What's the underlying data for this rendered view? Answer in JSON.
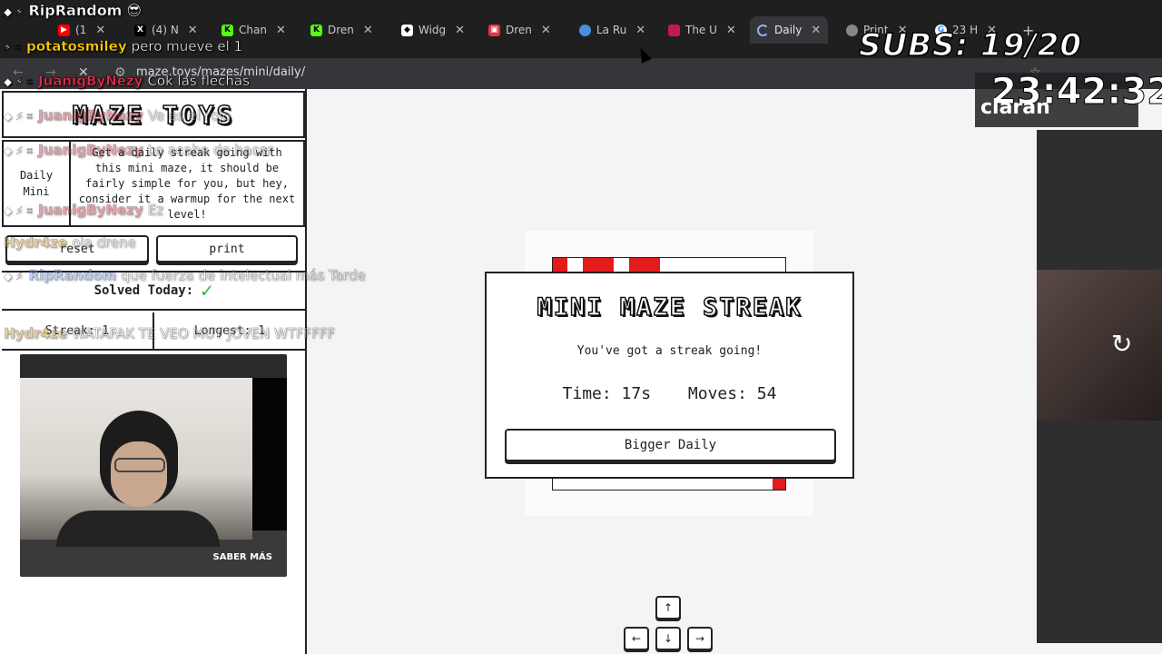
{
  "browser": {
    "tabs": [
      {
        "label": "(1",
        "fav": "youtube-icon",
        "color": "#ff0000"
      },
      {
        "label": "(4) N",
        "fav": "x-icon",
        "color": "#000000"
      },
      {
        "label": "Chan",
        "fav": "kick-icon",
        "color": "#53fc18"
      },
      {
        "label": "Dren",
        "fav": "kick-icon",
        "color": "#53fc18"
      },
      {
        "label": "Widg",
        "fav": "widget-icon",
        "color": "#ffffff"
      },
      {
        "label": "Dren",
        "fav": "app-icon",
        "color": "#e2344a"
      },
      {
        "label": "La Ru",
        "fav": "globe-icon",
        "color": "#4a90e2"
      },
      {
        "label": "The U",
        "fav": "app-icon",
        "color": "#c2185b"
      },
      {
        "label": "Daily",
        "fav": "loading-icon",
        "color": "#8ab4f8"
      },
      {
        "label": "Print",
        "fav": "globe-icon",
        "color": "#aaaaaa"
      },
      {
        "label": "23 H",
        "fav": "google-icon",
        "color": "#ffffff"
      }
    ],
    "url": "maze.toys/mazes/mini/daily/"
  },
  "page": {
    "logo": "MAZE TOYS",
    "tag_line1": "Daily",
    "tag_line2": "Mini",
    "info": "Get a daily streak going with this mini maze, it should be fairly simple for you, but hey, consider it a warmup for the next level!",
    "reset_label": "reset",
    "print_label": "print",
    "solved_label": "Solved Today:",
    "streak_label": "Streak: 1",
    "longest_label": "Longest: 1"
  },
  "modal": {
    "title": "MINI MAZE STREAK",
    "subtitle": "You've got a streak going!",
    "time": "Time: 17s",
    "moves": "Moves: 54",
    "button": "Bigger Daily"
  },
  "keys": {
    "up": "↑",
    "left": "←",
    "down": "↓",
    "right": "→"
  },
  "overlay": {
    "streamer": "RipRandom",
    "subs": "SUBS: 19/20",
    "clock": "23:42:32",
    "clock_sub": "claran",
    "saber_mas": "SABER MÁS",
    "chat": [
      {
        "user": "potatosmiley",
        "msg": "pero mueve el 1",
        "color": "#ffcc00"
      },
      {
        "user": "JuanigByNezy",
        "msg": "Cok las flechas",
        "color": "#d92c4a"
      },
      {
        "user": "JuanigByNezy",
        "msg": "Ve es el rojo",
        "color": "#d92c4a"
      },
      {
        "user": "JuanigByNezy",
        "msg": "Lo acabo de hacer",
        "color": "#d92c4a"
      },
      {
        "user": "JuanigByNezy",
        "msg": "Ez",
        "color": "#d92c4a"
      },
      {
        "user": "Hydr4ze",
        "msg": "ola drene",
        "color": "#e0a030"
      },
      {
        "user": "RipRandom",
        "msg": "que fuerza de intelectual más Tarde",
        "color": "#6aa0ff"
      },
      {
        "user": "Hydr4ze",
        "msg": "WATAFAK TE VEO MUY JOVEN WTFFFFF",
        "color": "#e0a030"
      }
    ]
  }
}
